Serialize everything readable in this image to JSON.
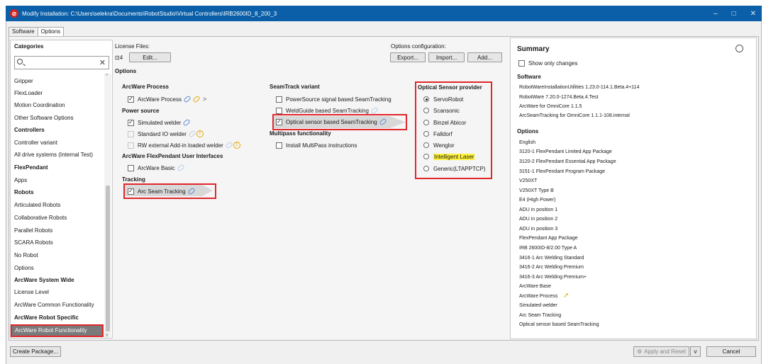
{
  "window": {
    "title": "Modify Installation: C:\\Users\\selekra\\Documents\\RobotStudio\\Virtual Controllers\\IRB2600ID_8_200_3",
    "controls": [
      "–",
      "□",
      "✕"
    ]
  },
  "tabs": [
    {
      "label": "Software",
      "active": false
    },
    {
      "label": "Options",
      "active": true
    }
  ],
  "categories": {
    "heading": "Categories",
    "search_placeholder": "",
    "items": [
      {
        "label": "Gripper",
        "bold": false
      },
      {
        "label": "FlexLoader",
        "bold": false
      },
      {
        "label": "Motion Coordination",
        "bold": false
      },
      {
        "label": "Other Software Options",
        "bold": false
      },
      {
        "label": "Controllers",
        "bold": true
      },
      {
        "label": "Controller variant",
        "bold": false
      },
      {
        "label": "All drive systems (Internal Test)",
        "bold": false
      },
      {
        "label": "FlexPendant",
        "bold": true
      },
      {
        "label": "Apps",
        "bold": false
      },
      {
        "label": "Robots",
        "bold": true
      },
      {
        "label": "Articulated Robots",
        "bold": false
      },
      {
        "label": "Collaborative Robots",
        "bold": false
      },
      {
        "label": "Parallel Robots",
        "bold": false
      },
      {
        "label": "SCARA Robots",
        "bold": false
      },
      {
        "label": "No Robot",
        "bold": false
      },
      {
        "label": "Options",
        "bold": false
      },
      {
        "label": "ArcWare System Wide",
        "bold": true
      },
      {
        "label": "License Level",
        "bold": false
      },
      {
        "label": "ArcWare Common Functionality",
        "bold": false
      },
      {
        "label": "ArcWare Robot Specific",
        "bold": true
      }
    ],
    "selected": "ArcWare Robot Functionality"
  },
  "license": {
    "label": "License Files:",
    "count": "4",
    "edit_button": "Edit..."
  },
  "options_config": {
    "label": "Options configuration:",
    "export_button": "Export...",
    "import_button": "Import...",
    "add_button": "Add..."
  },
  "options_heading": "Options",
  "col1": {
    "arcware_process": {
      "heading": "ArcWare Process",
      "item": "ArcWare Process"
    },
    "power_source": {
      "heading": "Power source",
      "items": [
        "Simulated welder",
        "Standard IO welder",
        "RW external Add-in loaded welder"
      ]
    },
    "flexpendant_ui": {
      "heading": "ArcWare FlexPendant User Interfaces",
      "item": "ArcWare Basic"
    },
    "tracking": {
      "heading": "Tracking",
      "item": "Arc Seam Tracking"
    }
  },
  "col2": {
    "seamtrack": {
      "heading": "SeamTrack variant",
      "items": [
        "PowerSource signal based SeamTracking",
        "WeldGuide based SeamTracking",
        "Optical sensor based SeamTracking"
      ]
    },
    "multipass": {
      "heading": "Multipass functionality",
      "item": "Install MultiPass instructions"
    }
  },
  "col3": {
    "heading": "Optical Sensor provider",
    "options": [
      "ServoRobot",
      "Scansonic",
      "Binzel Abicor",
      "Falldorf",
      "Wenglor",
      "Intelligent Laser",
      "Generic(LTAPPTCP)"
    ],
    "selected": "ServoRobot",
    "highlighted": "Intelligent Laser"
  },
  "summary": {
    "title": "Summary",
    "show_only_changes": "Show only changes",
    "software_heading": "Software",
    "software": [
      "RobotWareInstallationUtilities 1.23.0-114.1.Beta.4+114",
      "RobotWare 7.20.0-1274.Beta.4.Test",
      "ArcWare for OmniCore 1.1.5",
      "ArcSeamTracking for OmniCore 1.1.1-108.internal"
    ],
    "options_heading": "Options",
    "options": [
      "English",
      "3120-1 FlexPendant Limited App Package",
      "3120-2 FlexPendant Essential App Package",
      "3151-1 FlexPendant Program Package",
      "V250XT",
      "V250XT Type B",
      "E4 (High Power)",
      "ADU in position 1",
      "ADU in position 2",
      "ADU in position 3",
      "FlexPendant App Package",
      "IRB 2600ID-8/2.00 Type A",
      "3416-1 Arc Welding Standard",
      "3416-2 Arc Welding Premium",
      "3416-3 Arc Welding Premium+",
      "ArcWare Base",
      "ArcWare Process",
      "Simulated welder",
      "Arc Seam Tracking",
      "Optical sensor based SeamTracking"
    ]
  },
  "footer": {
    "create_package": "Create Package...",
    "apply_reset": "Apply and Reset",
    "cancel": "Cancel"
  },
  "colors": {
    "titlebar": "#0a5fa8",
    "highlight_box": "#e0272b",
    "marker": "#fff23a",
    "link": "#5a88d4"
  }
}
